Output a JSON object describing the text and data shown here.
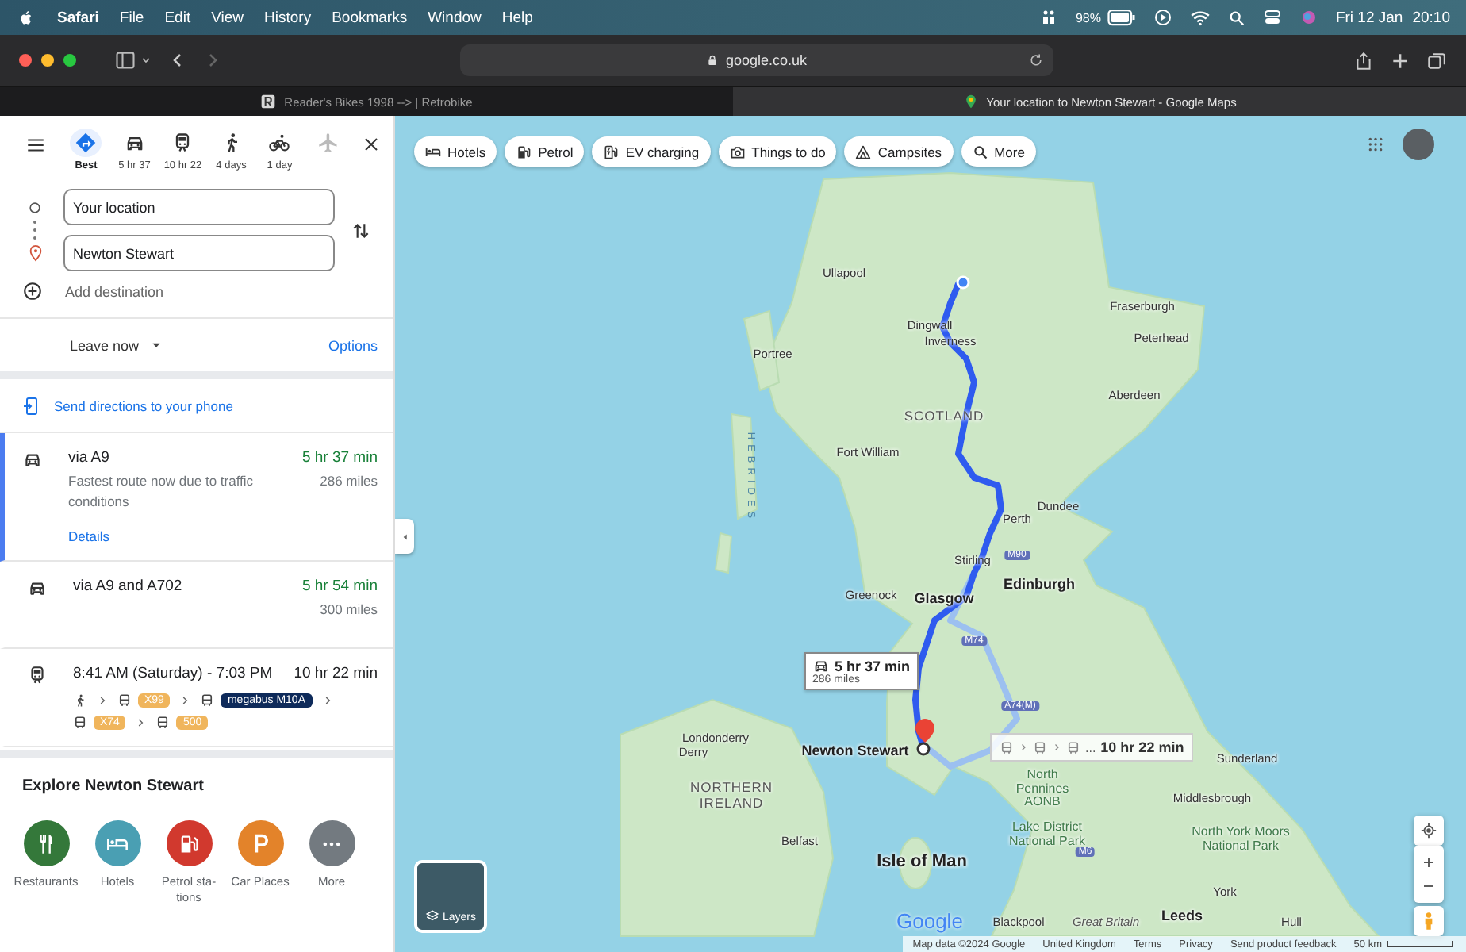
{
  "menu_bar": {
    "app": "Safari",
    "menus": [
      "File",
      "Edit",
      "View",
      "History",
      "Bookmarks",
      "Window",
      "Help"
    ],
    "battery": "98%",
    "date": "Fri 12 Jan",
    "time": "20:10"
  },
  "browser": {
    "address": "google.co.uk",
    "tabs": [
      {
        "title": "Reader's Bikes 1998 --> | Retrobike",
        "selected": false
      },
      {
        "title": "Your location to Newton Stewart - Google Maps",
        "selected": true
      }
    ]
  },
  "directions": {
    "modes": [
      {
        "kind": "best",
        "label": "Best",
        "selected": true,
        "disabled": false
      },
      {
        "kind": "car",
        "label": "5 hr 37",
        "selected": false,
        "disabled": false
      },
      {
        "kind": "train",
        "label": "10 hr 22",
        "selected": false,
        "disabled": false
      },
      {
        "kind": "walk",
        "label": "4 days",
        "selected": false,
        "disabled": false
      },
      {
        "kind": "bike",
        "label": "1 day",
        "selected": false,
        "disabled": false
      },
      {
        "kind": "plane",
        "selected": false,
        "disabled": true
      }
    ],
    "origin": {
      "value": "Your location"
    },
    "destination": {
      "value": "Newton Stewart"
    },
    "add_destination": "Add destination",
    "leave_time": "Leave now",
    "options": "Options",
    "send_to_phone": "Send directions to your phone",
    "routes": [
      {
        "kind": "drive",
        "selected": true,
        "title": "via A9",
        "duration": "5 hr 37 min",
        "note": "Fastest route now due to traffic conditions",
        "distance": "286 miles",
        "details": "Details"
      },
      {
        "kind": "drive",
        "selected": false,
        "title": "via A9 and A702",
        "duration": "5 hr 54 min",
        "distance": "300 miles"
      },
      {
        "kind": "transit",
        "selected": false,
        "title": "8:41 AM (Saturday) - 7:03 PM",
        "duration": "10 hr 22 min",
        "steps": [
          {
            "kind": "walk"
          },
          {
            "kind": "bus",
            "line": "X99",
            "color": "#f0b55c"
          },
          {
            "kind": "bus",
            "line": "megabus M10A",
            "color": "#0e2a5a"
          },
          {
            "kind": "bus",
            "line": "X74",
            "color": "#f0b55c"
          },
          {
            "kind": "bus",
            "line": "500",
            "color": "#f0b55c"
          }
        ]
      }
    ]
  },
  "explore": {
    "title": "Explore Newton Stewart",
    "categories": [
      {
        "kind": "restaurant",
        "label": "Restaurants",
        "color": "#34783a"
      },
      {
        "kind": "hotel",
        "label": "Hotels",
        "color": "#4a9fb3"
      },
      {
        "kind": "petrol",
        "label": "Petrol sta-tions",
        "color": "#d1392e"
      },
      {
        "kind": "parking",
        "label": "Car Places",
        "color": "#e3832a"
      },
      {
        "kind": "more",
        "label": "More",
        "color": "#737a80"
      }
    ]
  },
  "map": {
    "chips": [
      {
        "kind": "hotel",
        "label": "Hotels"
      },
      {
        "kind": "petrol",
        "label": "Petrol"
      },
      {
        "kind": "ev",
        "label": "EV charging"
      },
      {
        "kind": "camera",
        "label": "Things to do"
      },
      {
        "kind": "tent",
        "label": "Campsites"
      },
      {
        "kind": "search",
        "label": "More"
      }
    ],
    "places": [
      {
        "kind": "town",
        "label": "Ullapool"
      },
      {
        "kind": "town",
        "label": "Fraserburgh"
      },
      {
        "kind": "town",
        "label": "Dingwall"
      },
      {
        "kind": "town",
        "label": "Inverness"
      },
      {
        "kind": "town",
        "label": "Peterhead"
      },
      {
        "kind": "town",
        "label": "Portree"
      },
      {
        "kind": "town",
        "label": "Aberdeen"
      },
      {
        "kind": "region",
        "label": "SCOTLAND"
      },
      {
        "kind": "town",
        "label": "Fort William"
      },
      {
        "kind": "town",
        "label": "Dundee"
      },
      {
        "kind": "town",
        "label": "Perth"
      },
      {
        "kind": "town",
        "label": "Stirling"
      },
      {
        "kind": "city",
        "label": "Edinburgh"
      },
      {
        "kind": "town",
        "label": "Greenock"
      },
      {
        "kind": "city",
        "label": "Glasgow"
      },
      {
        "kind": "city",
        "label": "Newton Stewart"
      },
      {
        "kind": "town",
        "label": "Londonderry"
      },
      {
        "kind": "town",
        "label": "Derry"
      },
      {
        "kind": "region",
        "label": "NORTHERN IRELAND"
      },
      {
        "kind": "town",
        "label": "Belfast"
      },
      {
        "kind": "island",
        "label": "Isle of Man"
      },
      {
        "kind": "town",
        "label": "Sunderland"
      },
      {
        "kind": "park",
        "label": "North Pennines AONB"
      },
      {
        "kind": "town",
        "label": "Middlesbrough"
      },
      {
        "kind": "park",
        "label": "Lake District National Park"
      },
      {
        "kind": "park",
        "label": "North York Moors National Park"
      },
      {
        "kind": "town",
        "label": "York"
      },
      {
        "kind": "town",
        "label": "Blackpool"
      },
      {
        "kind": "area",
        "label": "Great Britain"
      },
      {
        "kind": "city",
        "label": "Leeds"
      },
      {
        "kind": "town",
        "label": "Hull"
      },
      {
        "kind": "sea",
        "label": "HEBRIDES"
      },
      {
        "kind": "road",
        "label": "M90"
      },
      {
        "kind": "road",
        "label": "M74"
      },
      {
        "kind": "road",
        "label": "A74(M)"
      },
      {
        "kind": "road",
        "label": "M6"
      }
    ],
    "callouts": [
      {
        "kind": "drive",
        "duration": "5 hr 37 min",
        "distance": "286 miles"
      },
      {
        "kind": "transit",
        "more": "...",
        "duration": "10 hr 22 min"
      }
    ],
    "layers": "Layers",
    "logo": "Google",
    "footer": [
      "Map data ©2024 Google",
      "United Kingdom",
      "Terms",
      "Privacy",
      "Send product feedback"
    ],
    "scale": "50 km"
  }
}
